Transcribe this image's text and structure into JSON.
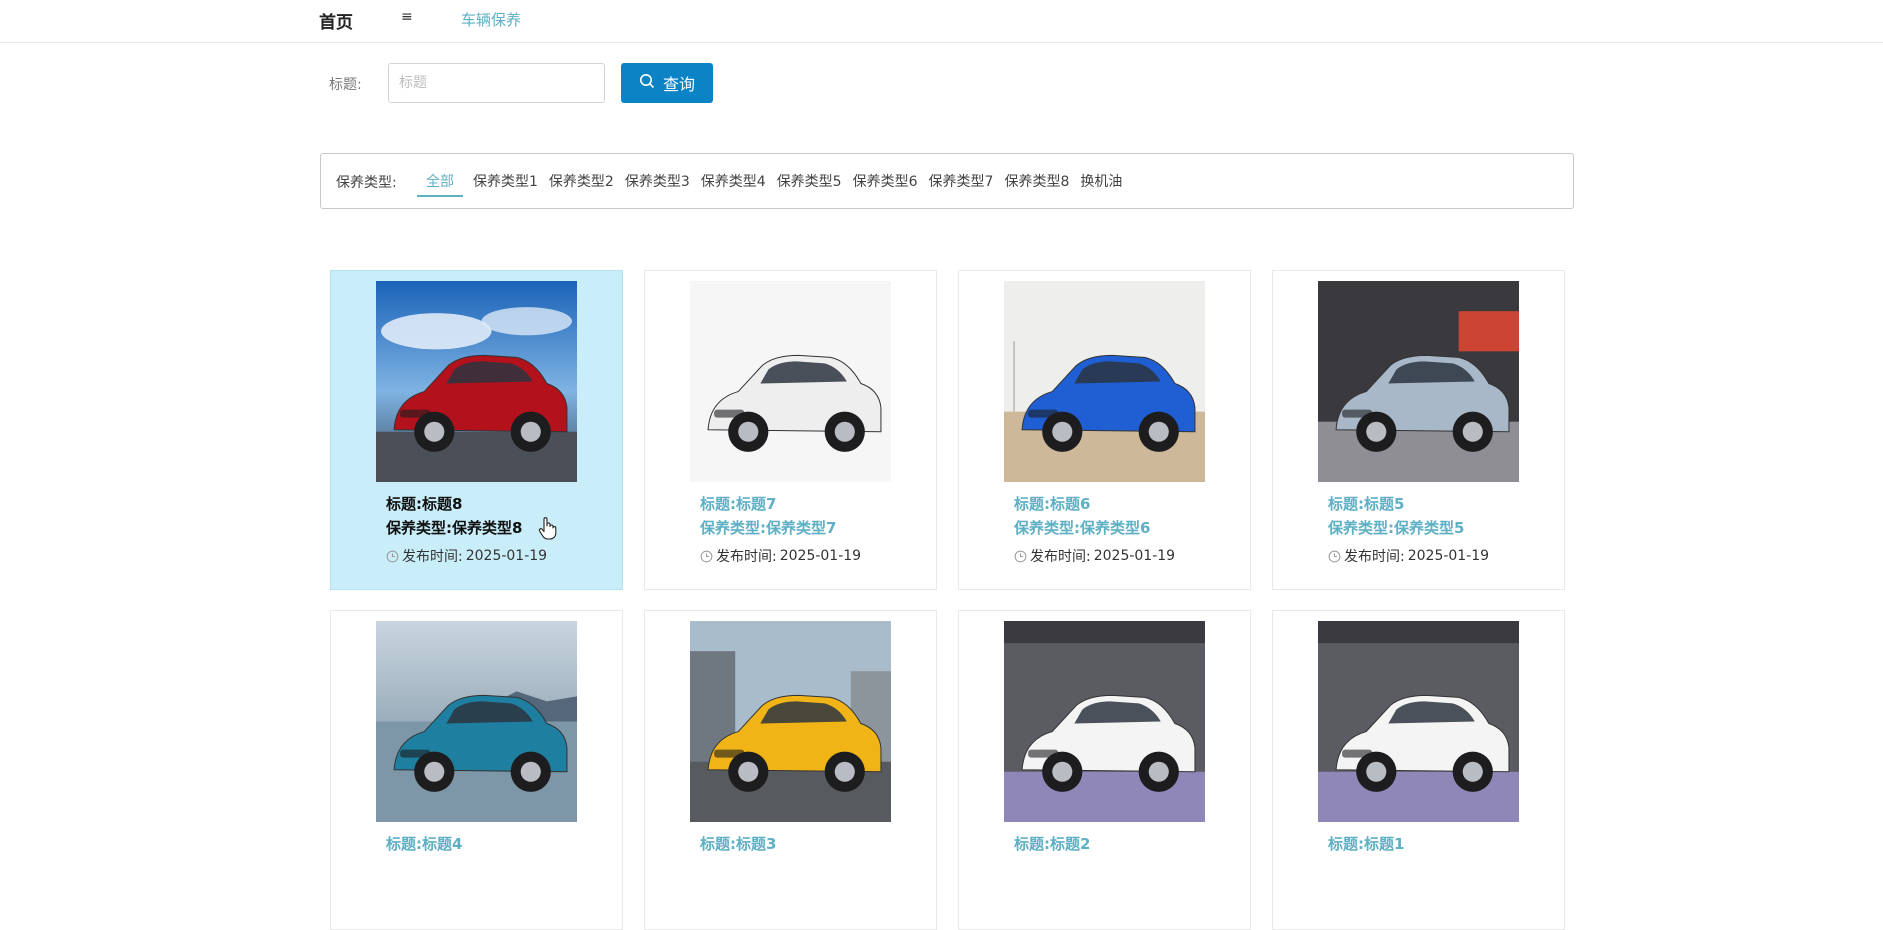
{
  "nav": {
    "home": "首页",
    "menu_icon": "≡",
    "current": "车辆保养"
  },
  "search": {
    "label": "标题:",
    "placeholder": "标题",
    "value": "",
    "button_label": "查询"
  },
  "filter": {
    "label": "保养类型:",
    "items": [
      "全部",
      "保养类型1",
      "保养类型2",
      "保养类型3",
      "保养类型4",
      "保养类型5",
      "保养类型6",
      "保养类型7",
      "保养类型8",
      "换机油"
    ],
    "active_index": 0
  },
  "cards": [
    {
      "title": "标题:标题8",
      "type": "保养类型:保养类型8",
      "time_label": "发布时间:",
      "time": "2025-01-19",
      "car_color": "#b3121c",
      "bg": "sky"
    },
    {
      "title": "标题:标题7",
      "type": "保养类型:保养类型7",
      "time_label": "发布时间:",
      "time": "2025-01-19",
      "car_color": "#eeeeee",
      "bg": "white"
    },
    {
      "title": "标题:标题6",
      "type": "保养类型:保养类型6",
      "time_label": "发布时间:",
      "time": "2025-01-19",
      "car_color": "#1f5fd3",
      "bg": "sand"
    },
    {
      "title": "标题:标题5",
      "type": "保养类型:保养类型5",
      "time_label": "发布时间:",
      "time": "2025-01-19",
      "car_color": "#a9b8c9",
      "bg": "show"
    },
    {
      "title": "标题:标题4",
      "type": "",
      "time_label": "",
      "time": "",
      "car_color": "#1e7fa0",
      "bg": "lake"
    },
    {
      "title": "标题:标题3",
      "type": "",
      "time_label": "",
      "time": "",
      "car_color": "#f0b416",
      "bg": "city"
    },
    {
      "title": "标题:标题2",
      "type": "",
      "time_label": "",
      "time": "",
      "car_color": "#f4f4f4",
      "bg": "expo"
    },
    {
      "title": "标题:标题1",
      "type": "",
      "time_label": "",
      "time": "",
      "car_color": "#f4f4f4",
      "bg": "expo"
    }
  ],
  "colors": {
    "accent": "#5eb0c4",
    "button": "#0b83c4",
    "hover_card": "#c9eefa"
  }
}
